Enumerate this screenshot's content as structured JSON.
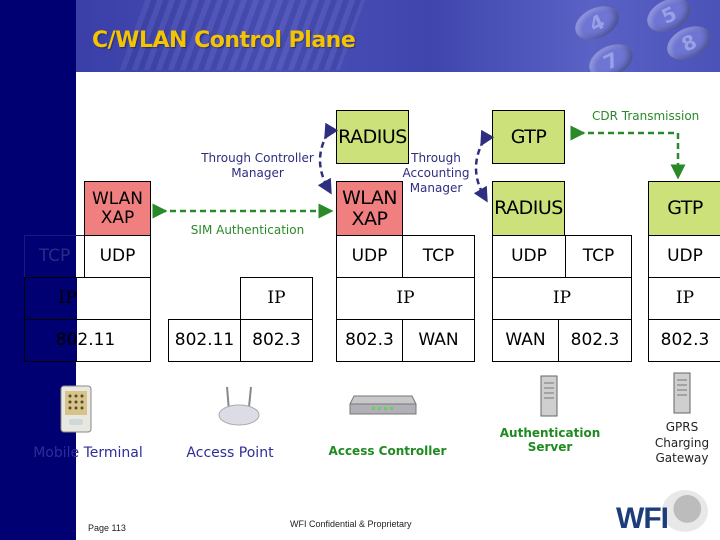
{
  "slide": {
    "title": "C/WLAN Control Plane",
    "page": "Page 113",
    "confidential": "WFI Confidential & Proprietary",
    "logo": "WFI"
  },
  "colors": {
    "title": "#f5c400",
    "sidebar": "#000072",
    "green_box": "#cce17a",
    "red_box": "#f08080",
    "flow_green": "#2a8a2a",
    "flow_navy": "#2e2e80"
  },
  "annotations": {
    "through_controller": "Through Controller\nManager",
    "through_controller_l1": "Through Controller",
    "through_controller_l2": "Manager",
    "sim_auth": "SIM Authentication",
    "through_accounting_l1": "Through",
    "through_accounting_l2": "Accounting",
    "through_accounting_l3": "Manager",
    "cdr": "CDR Transmission"
  },
  "stacks": {
    "mobile_terminal": {
      "app": "WLAN\nXAP",
      "app_l1": "WLAN",
      "app_l2": "XAP",
      "transport": [
        "TCP",
        "UDP"
      ],
      "network": "IP",
      "link": "802.11"
    },
    "access_point": {
      "network": "IP",
      "link": [
        "802.11",
        "802.3"
      ]
    },
    "access_controller": {
      "top": "RADIUS",
      "app_l1": "WLAN",
      "app_l2": "XAP",
      "transport": [
        "UDP",
        "TCP"
      ],
      "network": "IP",
      "link": [
        "802.3",
        "WAN"
      ]
    },
    "auth_server": {
      "top": "GTP",
      "app": "RADIUS",
      "transport": [
        "UDP",
        "TCP"
      ],
      "network": "IP",
      "link": [
        "WAN",
        "802.3"
      ]
    },
    "charging_gateway": {
      "app": "GTP",
      "transport": "UDP",
      "network": "IP",
      "link": "802.3"
    }
  },
  "devices": [
    {
      "name": "Mobile Terminal",
      "icon": "pda-icon"
    },
    {
      "name": "Access Point",
      "icon": "wireless-router-icon"
    },
    {
      "name": "Access Controller",
      "icon": "network-switch-icon"
    },
    {
      "name": "Authentication\nServer",
      "l1": "Authentication",
      "l2": "Server",
      "icon": "server-tower-icon"
    },
    {
      "name": "GPRS\nCharging\nGateway",
      "l1": "GPRS",
      "l2": "Charging",
      "l3": "Gateway",
      "icon": "server-tower-icon"
    }
  ]
}
